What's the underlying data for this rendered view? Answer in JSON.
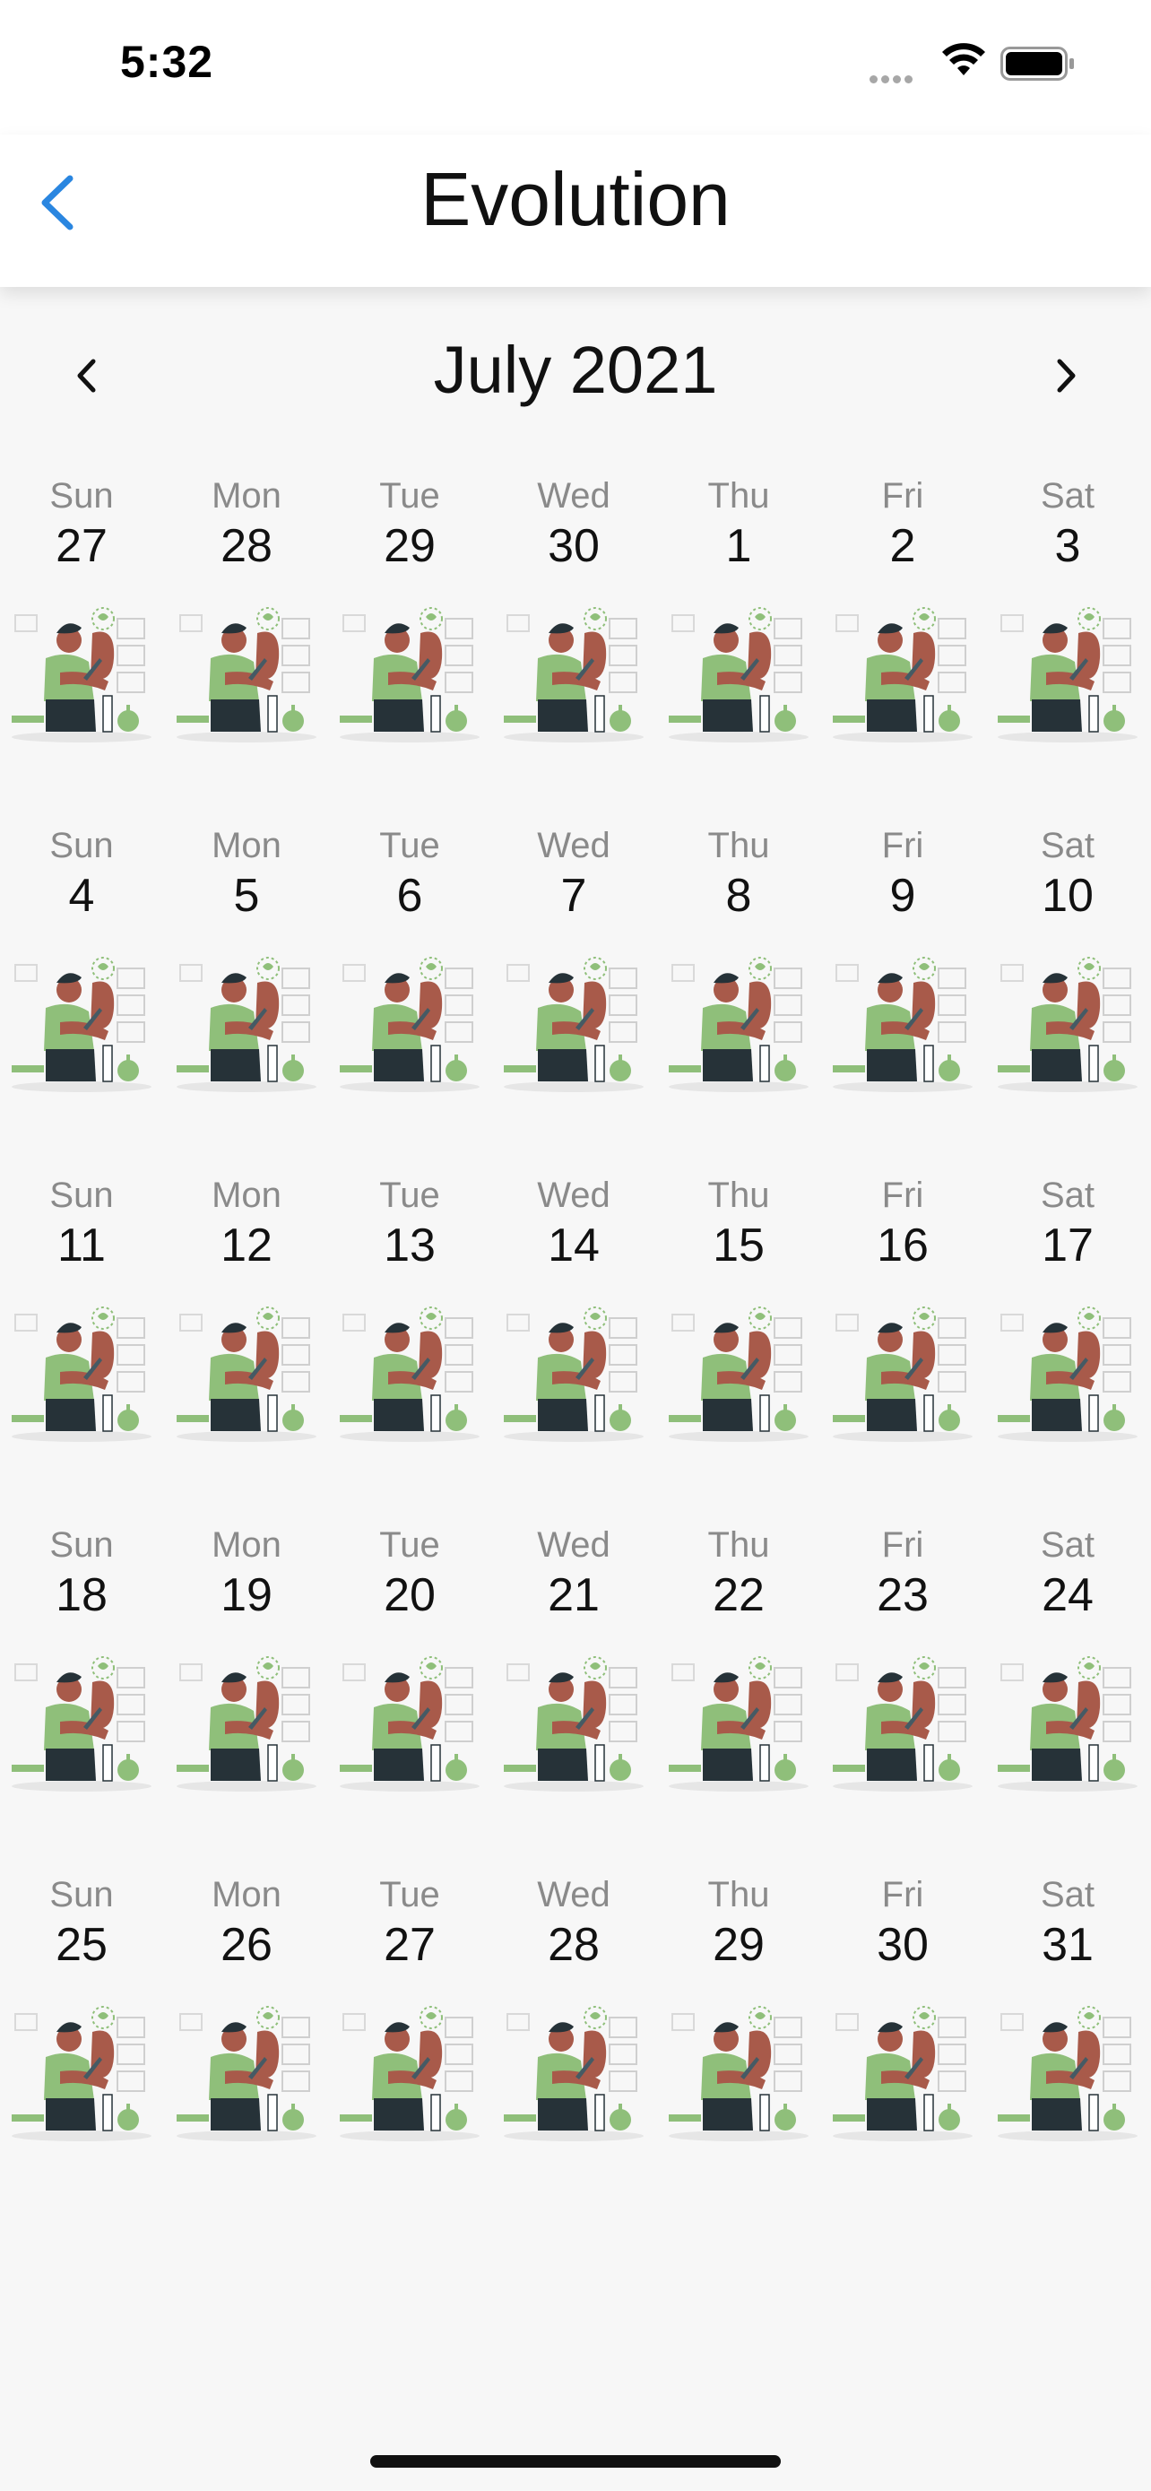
{
  "status_bar": {
    "time": "5:32",
    "icons": [
      "signal-icon",
      "wifi-icon",
      "battery-icon"
    ]
  },
  "nav": {
    "title": "Evolution",
    "back_icon": "chevron-left-icon",
    "accent_color": "#2a86e0"
  },
  "calendar": {
    "month_label": "July 2021",
    "prev_icon": "chevron-left-icon",
    "next_icon": "chevron-right-icon",
    "weeks": [
      [
        {
          "dow": "Sun",
          "day": "27"
        },
        {
          "dow": "Mon",
          "day": "28"
        },
        {
          "dow": "Tue",
          "day": "29"
        },
        {
          "dow": "Wed",
          "day": "30"
        },
        {
          "dow": "Thu",
          "day": "1"
        },
        {
          "dow": "Fri",
          "day": "2"
        },
        {
          "dow": "Sat",
          "day": "3"
        }
      ],
      [
        {
          "dow": "Sun",
          "day": "4"
        },
        {
          "dow": "Mon",
          "day": "5"
        },
        {
          "dow": "Tue",
          "day": "6"
        },
        {
          "dow": "Wed",
          "day": "7"
        },
        {
          "dow": "Thu",
          "day": "8"
        },
        {
          "dow": "Fri",
          "day": "9"
        },
        {
          "dow": "Sat",
          "day": "10"
        }
      ],
      [
        {
          "dow": "Sun",
          "day": "11"
        },
        {
          "dow": "Mon",
          "day": "12"
        },
        {
          "dow": "Tue",
          "day": "13"
        },
        {
          "dow": "Wed",
          "day": "14"
        },
        {
          "dow": "Thu",
          "day": "15"
        },
        {
          "dow": "Fri",
          "day": "16"
        },
        {
          "dow": "Sat",
          "day": "17"
        }
      ],
      [
        {
          "dow": "Sun",
          "day": "18"
        },
        {
          "dow": "Mon",
          "day": "19"
        },
        {
          "dow": "Tue",
          "day": "20"
        },
        {
          "dow": "Wed",
          "day": "21"
        },
        {
          "dow": "Thu",
          "day": "22"
        },
        {
          "dow": "Fri",
          "day": "23"
        },
        {
          "dow": "Sat",
          "day": "24"
        }
      ],
      [
        {
          "dow": "Sun",
          "day": "25"
        },
        {
          "dow": "Mon",
          "day": "26"
        },
        {
          "dow": "Tue",
          "day": "27"
        },
        {
          "dow": "Wed",
          "day": "28"
        },
        {
          "dow": "Thu",
          "day": "29"
        },
        {
          "dow": "Fri",
          "day": "30"
        },
        {
          "dow": "Sat",
          "day": "31"
        }
      ]
    ],
    "day_image": "person-with-plants-illustration",
    "colors": {
      "weekday": "#8a8a8a",
      "day_number": "#111111",
      "illustration_green": "#8fbf7a",
      "illustration_skin": "#a85a4a",
      "illustration_dark": "#263238"
    }
  }
}
